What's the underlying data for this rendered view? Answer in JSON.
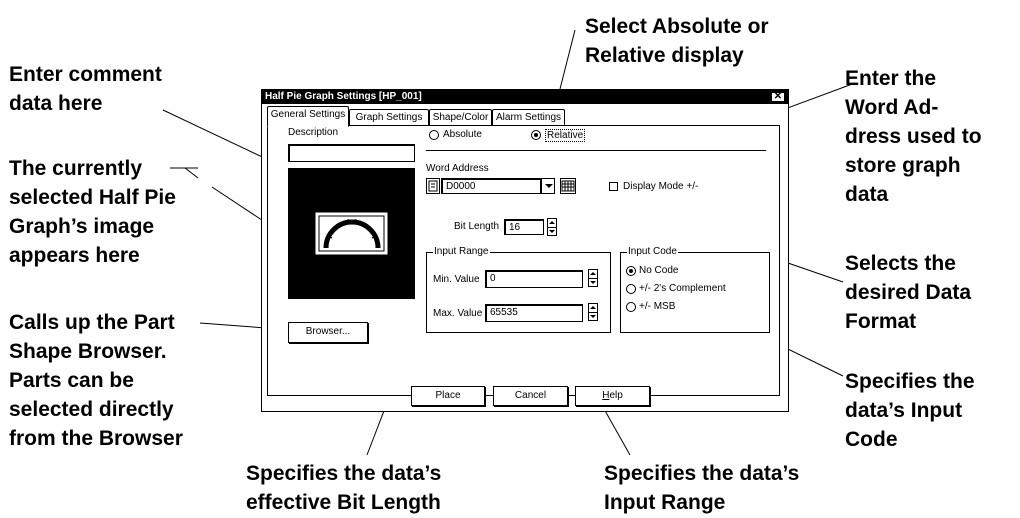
{
  "callouts": {
    "comment": [
      "Enter comment",
      "data here"
    ],
    "image": [
      "The currently",
      "selected Half Pie",
      "Graph’s image",
      "appears here"
    ],
    "browser": [
      "Calls up the Part",
      "Shape Browser.",
      "Parts can be",
      "selected directly",
      "from the Browser"
    ],
    "bitlength": [
      "Specifies the data’s",
      "effective Bit Length"
    ],
    "inputrange": [
      "Specifies the data’s",
      "Input Range"
    ],
    "absrel": [
      "Select Absolute or",
      "Relative display"
    ],
    "wordaddr": [
      "Enter the",
      "Word Ad-",
      "dress used to",
      "store graph",
      "data"
    ],
    "dataformat": [
      "Selects the",
      "desired Data",
      "Format"
    ],
    "inputcode": [
      "Specifies the",
      "data’s Input",
      "Code"
    ]
  },
  "dialog": {
    "title": "Half Pie Graph Settings [HP_001]",
    "close_glyph": "✕",
    "tabs": [
      "General Settings",
      "Graph Settings",
      "Shape/Color",
      "Alarm Settings"
    ],
    "description_label": "Description",
    "description_value": "",
    "browser_button": "Browser...",
    "absolute_label": "Absolute",
    "relative_label": "Relative",
    "display_selected": "Relative",
    "word_address_label": "Word Address",
    "word_address_value": "D0000",
    "display_mode_label": "Display Mode +/-",
    "display_mode_checked": false,
    "bit_length_label": "Bit Length",
    "bit_length_value": "16",
    "input_range": {
      "title": "Input Range",
      "min_label": "Min. Value",
      "min_value": "0",
      "max_label": "Max. Value",
      "max_value": "65535"
    },
    "input_code": {
      "title": "Input Code",
      "options": [
        "No Code",
        "+/- 2's Complement",
        "+/- MSB"
      ],
      "selected": "No Code"
    },
    "buttons": {
      "place": "Place",
      "cancel": "Cancel",
      "help": "Help"
    }
  }
}
